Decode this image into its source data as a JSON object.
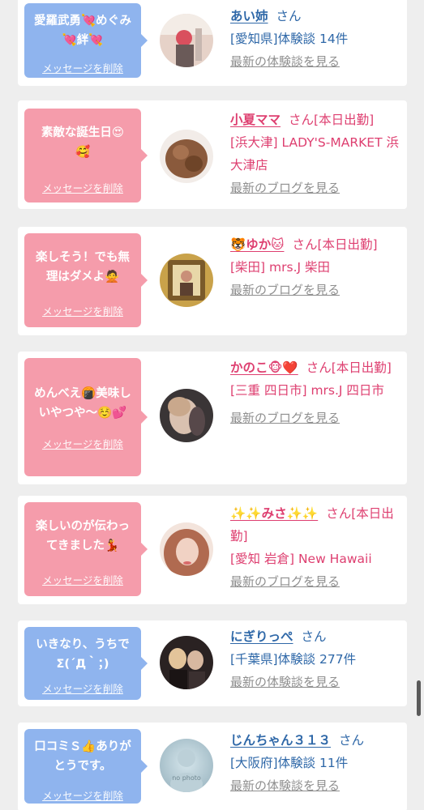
{
  "delete_label": "メッセージを削除",
  "honorific": "さん",
  "cards": [
    {
      "theme": "blue",
      "message": "愛羅武勇💘めぐみ\n💘絆💘",
      "name": "あい姉",
      "suffix": "",
      "area": "[愛知県]体験談 14件",
      "link": "最新の体験談を見る"
    },
    {
      "theme": "pink",
      "message": "素敵な誕生日😍\n🥰",
      "name": "小夏ママ",
      "suffix": "[本日出勤]",
      "area": "[浜大津] LADY'S-MARKET 浜大津店",
      "link": "最新のブログを見る"
    },
    {
      "theme": "pink",
      "message": "楽しそう！でも無\n理はダメよ🙅",
      "name": "🐯ゆか🐱",
      "suffix": "[本日出勤]",
      "area": "[柴田] mrs.J 柴田",
      "link": "最新のブログを見る"
    },
    {
      "theme": "pink",
      "message": "めんべえ🍘美味し\nいやつや〜☺️💕",
      "name": "かのこ🐵❤️",
      "suffix": "[本日出勤]",
      "area": "[三重 四日市] mrs.J 四日市",
      "link": "最新のブログを見る"
    },
    {
      "theme": "pink",
      "message": "楽しいのが伝わっ\nてきました💃",
      "name": "✨✨みさ✨✨",
      "suffix": "[本日出勤]",
      "area": "[愛知 岩倉] New Hawaii",
      "link": "最新のブログを見る"
    },
    {
      "theme": "blue",
      "message": "いきなり、うちで\nΣ(´Д｀；)",
      "name": "にぎりっぺ",
      "suffix": "",
      "area": "[千葉県]体験談 277件",
      "link": "最新の体験談を見る"
    },
    {
      "theme": "blue",
      "message": "口コミＳ👍ありが\nとうです。",
      "name": "じんちゃん３１３",
      "suffix": "",
      "area": "[大阪府]体験談 11件",
      "link": "最新の体験談を見る",
      "avatar_text": "no photo"
    }
  ]
}
